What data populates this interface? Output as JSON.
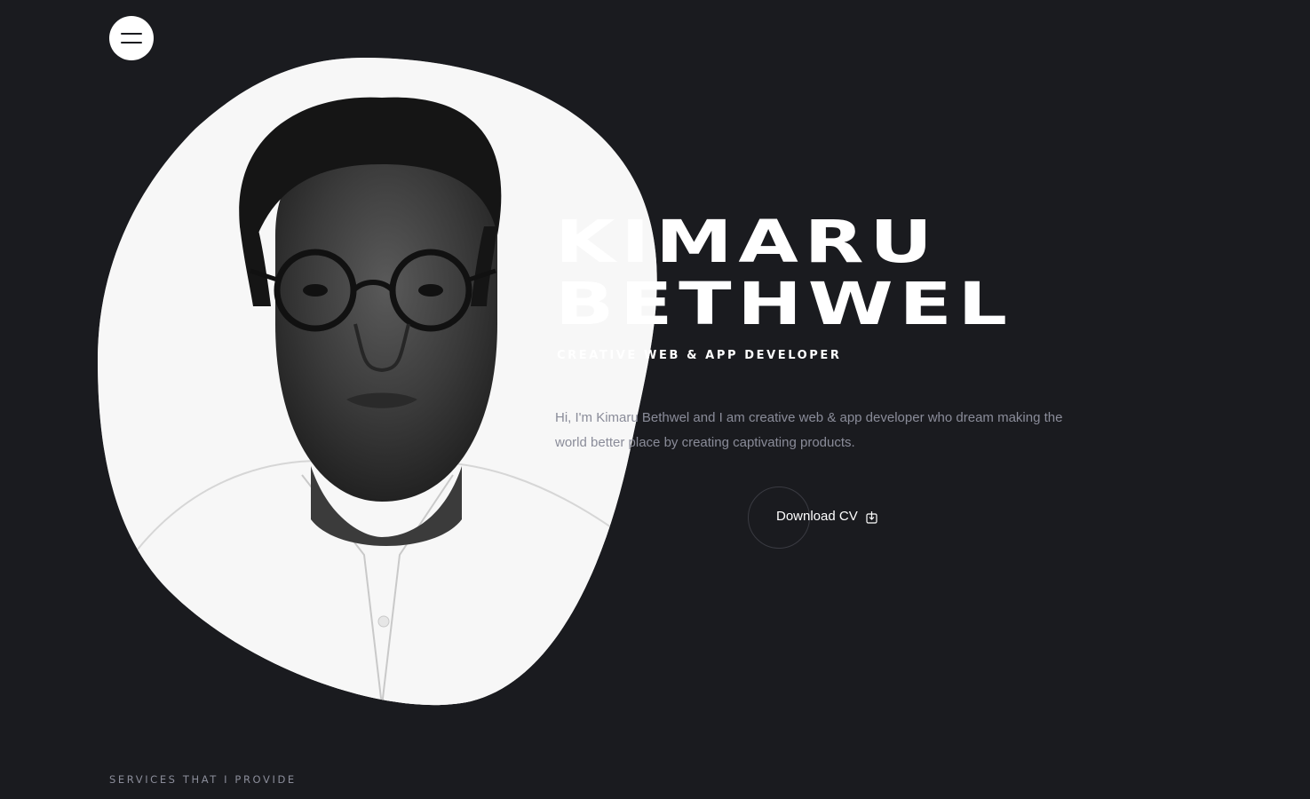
{
  "header": {
    "menu_icon": "hamburger-menu-icon"
  },
  "hero": {
    "name_line1": "KIMARU",
    "name_line2": "BETHWEL",
    "role": "CREATIVE WEB & APP DEVELOPER",
    "intro": "Hi, I'm Kimaru Bethwel and I am creative web & app developer who dream making the world better place by creating captivating products.",
    "download_label": "Download CV",
    "download_icon": "download-icon",
    "portrait_description": "black and white portrait photo"
  },
  "services": {
    "heading": "SERVICES THAT I PROVIDE"
  },
  "colors": {
    "background": "#1a1b1f",
    "text_primary": "#ffffff",
    "text_muted": "#8a8c99",
    "circle_border": "#3a3b42"
  }
}
